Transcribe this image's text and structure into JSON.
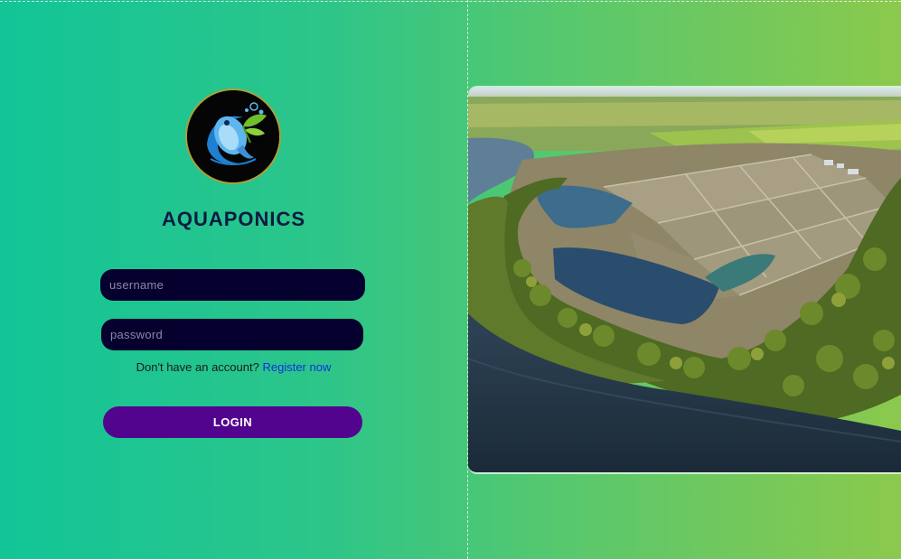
{
  "app": {
    "name": "AQUAPONICS",
    "logo_icon": "fish-plant-logo-icon",
    "hero_image": "aquaculture-ponds-aerial-image"
  },
  "login_form": {
    "username_placeholder": "username",
    "password_placeholder": "password",
    "register_prompt": "Don't have an account?",
    "register_link": "Register now",
    "login_button": "LOGIN"
  },
  "colors": {
    "background_start": "#12c597",
    "background_end": "#8bc94c",
    "input_background": "#06002e",
    "button_background": "#53048f",
    "link": "#1030e0",
    "title": "#0c1a40"
  }
}
